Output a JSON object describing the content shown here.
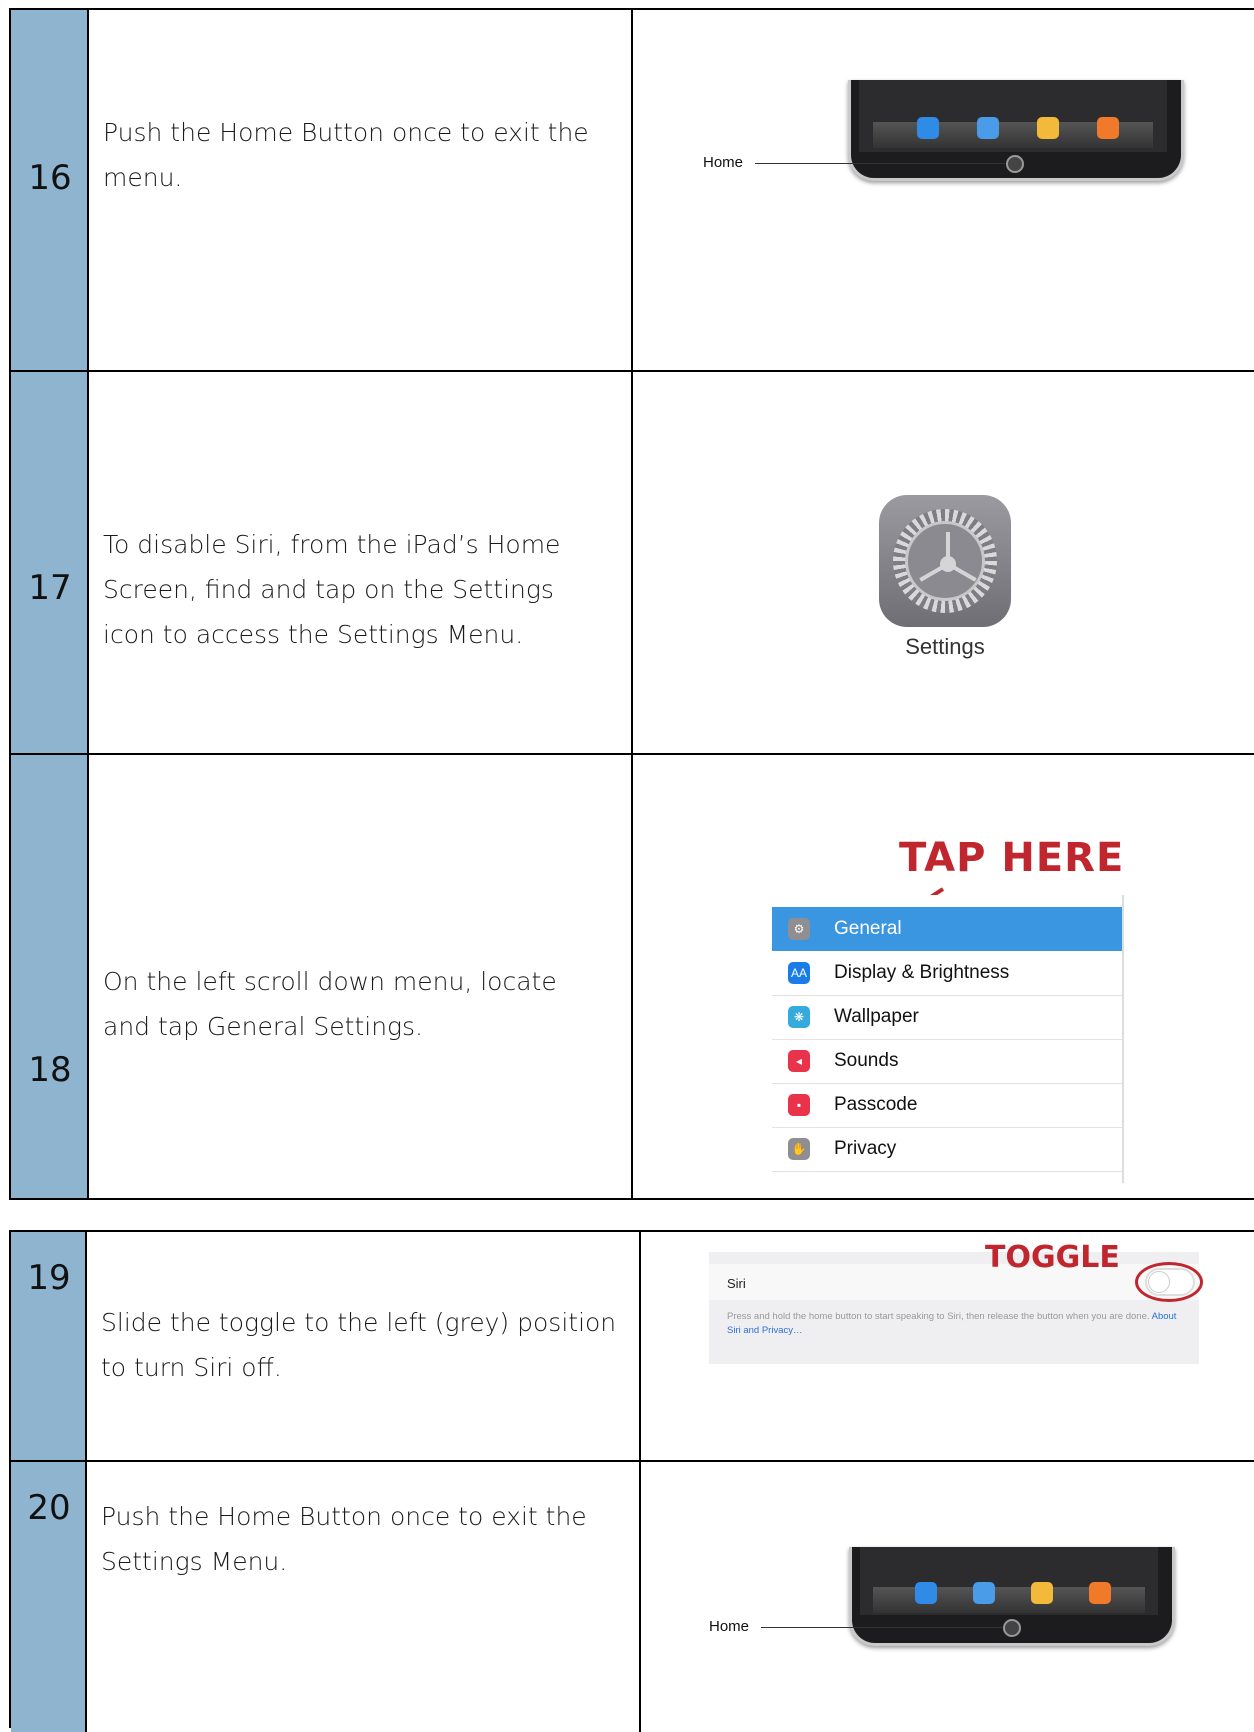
{
  "steps": [
    {
      "number": "16",
      "text": "Push the Home Button once to exit the menu.",
      "image": {
        "home_label": "Home"
      }
    },
    {
      "number": "17",
      "text": "To disable Siri, from the iPad’s Home Screen, find and tap on the Settings icon to access the Settings Menu.",
      "image": {
        "icon_name": "settings-app-icon",
        "label": "Settings"
      }
    },
    {
      "number": "18",
      "text": "On the left scroll down menu, locate and tap General Settings.",
      "image": {
        "callout": "TAP HERE",
        "menu": [
          {
            "label": "General",
            "icon": "gear-icon",
            "color": "#8e8e93",
            "glyph": "⚙",
            "selected": true
          },
          {
            "label": "Display & Brightness",
            "icon": "display-icon",
            "color": "#1a7ce6",
            "glyph": "AA",
            "selected": false
          },
          {
            "label": "Wallpaper",
            "icon": "wallpaper-icon",
            "color": "#35aadc",
            "glyph": "❋",
            "selected": false
          },
          {
            "label": "Sounds",
            "icon": "speaker-icon",
            "color": "#e8334a",
            "glyph": "◂",
            "selected": false
          },
          {
            "label": "Passcode",
            "icon": "lock-icon",
            "color": "#e8334a",
            "glyph": "▪",
            "selected": false
          },
          {
            "label": "Privacy",
            "icon": "hand-icon",
            "color": "#8e8e93",
            "glyph": "✋",
            "selected": false
          }
        ]
      }
    },
    {
      "number": "19",
      "text": "Slide the toggle to the left (grey) position to turn Siri off.",
      "image": {
        "callout": "TOGGLE",
        "setting_label": "Siri",
        "description": "Press and hold the home button to start speaking to Siri, then release the button when you are done.",
        "link": "About Siri and Privacy…"
      }
    },
    {
      "number": "20",
      "text": "Push the Home Button once to exit the Settings Menu.",
      "image": {
        "home_label": "Home"
      }
    }
  ],
  "colors": {
    "number_column": "#8fb4cf",
    "callout": "#c0262d",
    "selected_row": "#3b96e2"
  }
}
